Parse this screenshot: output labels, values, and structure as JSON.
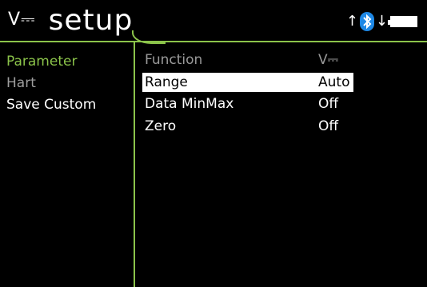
{
  "header": {
    "dc_symbol": "V⎓",
    "title": "setup"
  },
  "status_icons": {
    "up_arrow": "↑",
    "down_arrow": "↓",
    "bluetooth": "bluetooth-icon",
    "battery": "battery-icon"
  },
  "menu": {
    "items": [
      {
        "label": "Parameter",
        "color": "#8bc34a"
      },
      {
        "label": "Hart",
        "color": "#9e9e9e"
      },
      {
        "label": "Save  Custom",
        "color": "#ffffff"
      }
    ]
  },
  "settings": {
    "rows": [
      {
        "label": "Function",
        "value": "V⎓"
      },
      {
        "label": "Range",
        "value": "Auto"
      },
      {
        "label": "Data  MinMax",
        "value": "Off"
      },
      {
        "label": "Zero",
        "value": "Off"
      }
    ]
  },
  "colors": {
    "accent": "#8bc34a",
    "bluetooth": "#1e88e5",
    "background": "#000000"
  }
}
